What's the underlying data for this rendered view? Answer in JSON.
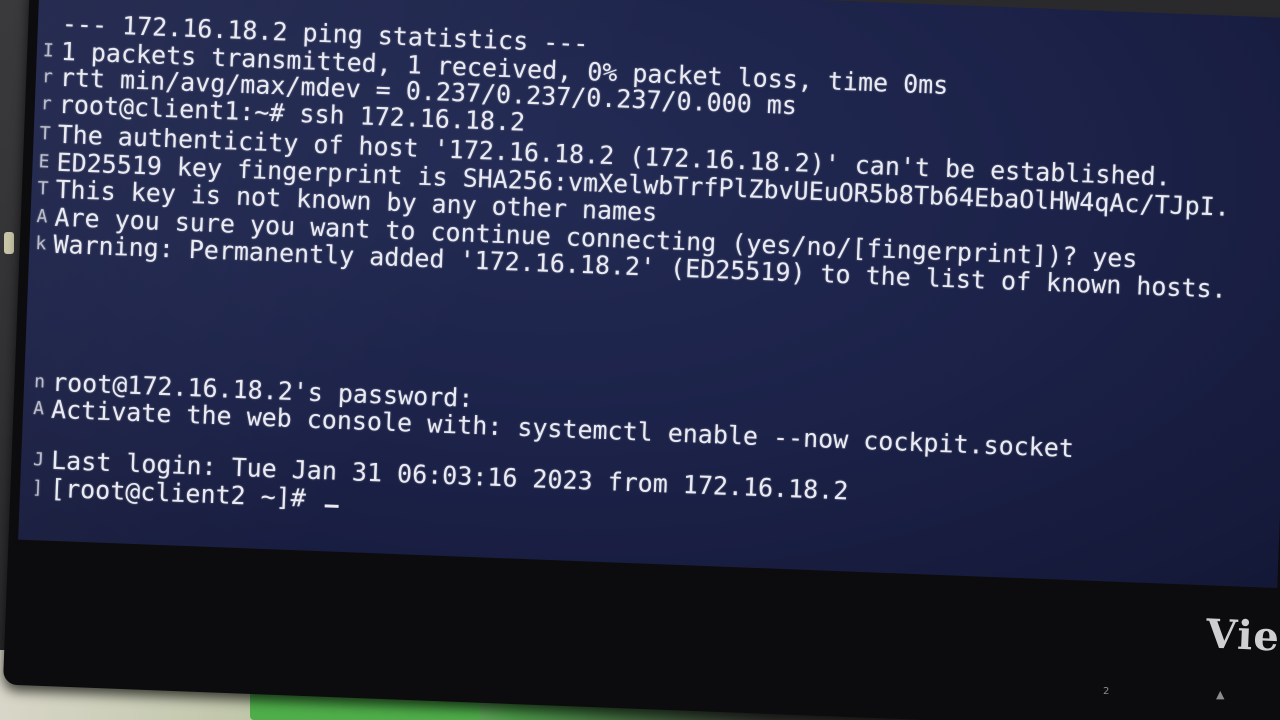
{
  "terminal": {
    "lines": [
      "--- 172.16.18.2 ping statistics ---",
      "1 packets transmitted, 1 received, 0% packet loss, time 0ms",
      "rtt min/avg/max/mdev = 0.237/0.237/0.237/0.000 ms",
      "root@client1:~# ssh 172.16.18.2",
      "The authenticity of host '172.16.18.2 (172.16.18.2)' can't be established.",
      "ED25519 key fingerprint is SHA256:vmXelwbTrfPlZbvUEuOR5b8Tb64EbaOlHW4qAc/TJpI.",
      "This key is not known by any other names",
      "Are you sure you want to continue connecting (yes/no/[fingerprint])? yes",
      "Warning: Permanently added '172.16.18.2' (ED25519) to the list of known hosts.",
      "root@172.16.18.2's password:",
      "Activate the web console with: systemctl enable --now cockpit.socket",
      "Last login: Tue Jan 31 06:03:16 2023 from 172.16.18.2",
      "[root@client2 ~]# "
    ],
    "gutter_marks": [
      "",
      "I",
      "r",
      "r",
      "T",
      "E",
      "T",
      "A",
      "k",
      "n",
      "A",
      "J",
      "]"
    ]
  },
  "monitor": {
    "brand": "Vie",
    "bottom_mark": "2",
    "arrow_mark": "▲"
  }
}
